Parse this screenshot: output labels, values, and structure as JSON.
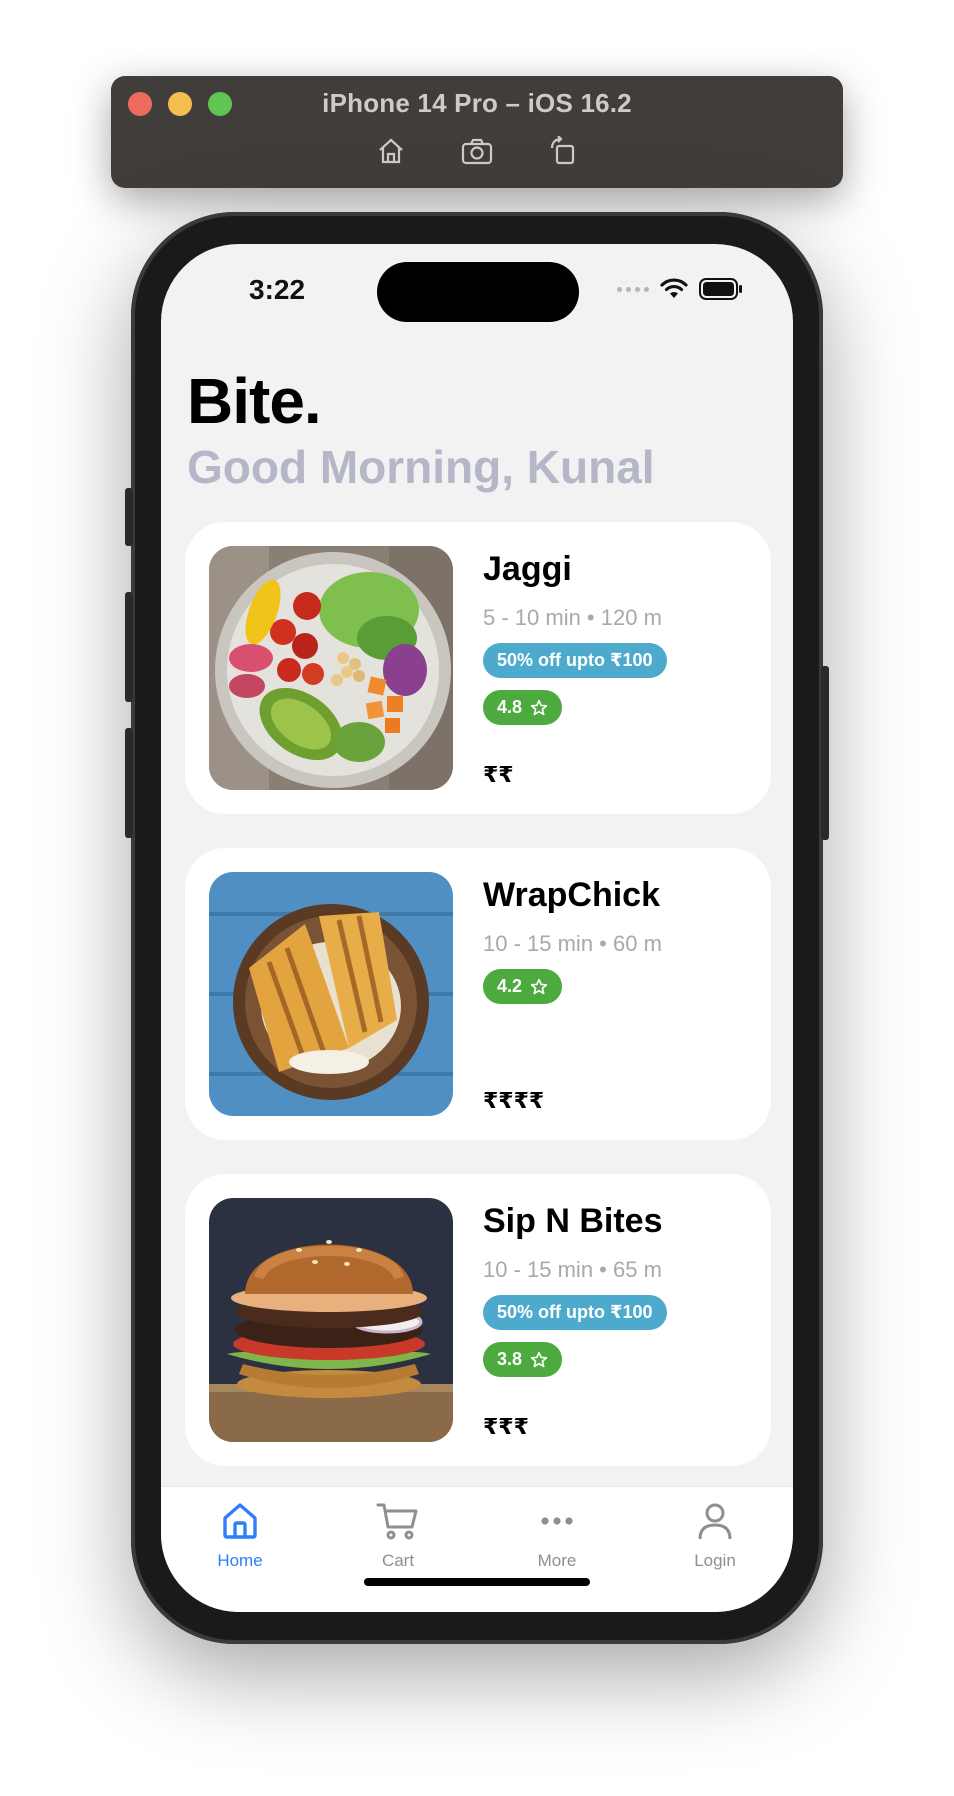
{
  "simulator": {
    "title": "iPhone 14 Pro – iOS 16.2",
    "tools": [
      "home-icon",
      "screenshot-icon",
      "rotate-icon"
    ]
  },
  "status_bar": {
    "time": "3:22"
  },
  "header": {
    "brand": "Bite.",
    "greeting": "Good Morning, Kunal"
  },
  "restaurants": [
    {
      "name": "Jaggi",
      "meta": "5 - 10 min • 120 m",
      "offer": "50% off upto ₹100",
      "rating": "4.8",
      "price": "₹₹",
      "image": "salad-bowl-image"
    },
    {
      "name": "WrapChick",
      "meta": "10 - 15 min • 60 m",
      "offer": "",
      "rating": "4.2",
      "price": "₹₹₹₹",
      "image": "sandwich-image"
    },
    {
      "name": "Sip N Bites",
      "meta": "10 - 15 min • 65 m",
      "offer": "50% off upto ₹100",
      "rating": "3.8",
      "price": "₹₹₹",
      "image": "burger-image"
    }
  ],
  "tabs": [
    {
      "label": "Home",
      "icon": "home-icon",
      "active": true
    },
    {
      "label": "Cart",
      "icon": "cart-icon",
      "active": false
    },
    {
      "label": "More",
      "icon": "more-icon",
      "active": false
    },
    {
      "label": "Login",
      "icon": "person-icon",
      "active": false
    }
  ],
  "colors": {
    "accent": "#2d7ff9",
    "offer_badge": "#4eaacd",
    "rating_badge": "#4caa3f",
    "greeting": "#b5b7c9",
    "inactive_tab": "#8e8e93"
  }
}
